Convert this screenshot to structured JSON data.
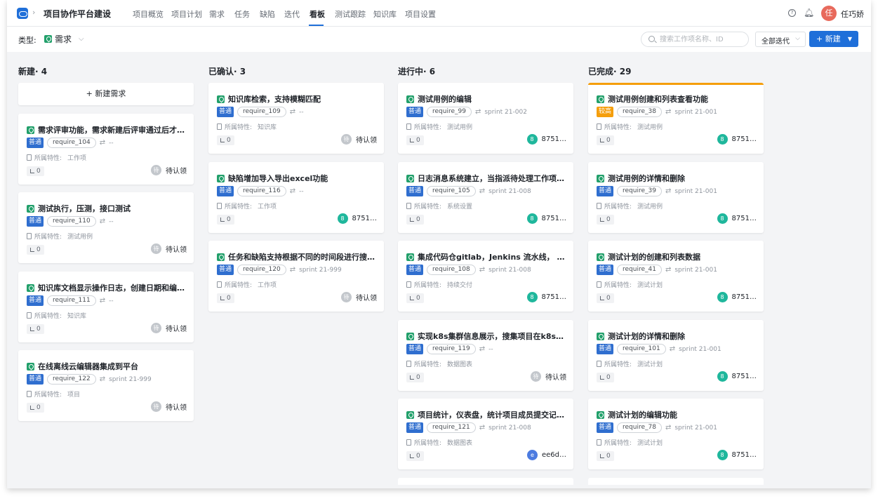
{
  "topnav": {
    "project_name": "项目协作平台建设",
    "tabs": [
      "项目概览",
      "项目计划",
      "需求",
      "任务",
      "缺陷",
      "迭代",
      "看板",
      "测试跟踪",
      "知识库",
      "项目设置"
    ],
    "active_tab": "看板",
    "user_avatar": "任",
    "user_name": "任巧娇"
  },
  "toolbar": {
    "type_label": "类型:",
    "type_value": "需求",
    "search_placeholder": "搜索工作项名称、ID",
    "iteration_select": "全部迭代",
    "new_button": "新建"
  },
  "labels": {
    "feature_label": "所属特性:",
    "add_requirement": "+ 新建需求"
  },
  "columns": [
    {
      "title": "新建· 4",
      "cards": [
        {
          "title": "需求评审功能，需求新建后评审通过后才能…",
          "priority": "普通",
          "key": "require_104",
          "sprint": "--",
          "feature": "工作项",
          "subtasks": "0",
          "assignee": "待认领",
          "avatar": "待"
        },
        {
          "title": "测试执行，压测，接口测试",
          "priority": "普通",
          "key": "require_110",
          "sprint": "--",
          "feature": "测试用例",
          "subtasks": "0",
          "assignee": "待认领",
          "avatar": "待"
        },
        {
          "title": "知识库文档显示操作日志，创建日期和编辑…",
          "priority": "普通",
          "key": "require_111",
          "sprint": "--",
          "feature": "知识库",
          "subtasks": "0",
          "assignee": "待认领",
          "avatar": "待"
        },
        {
          "title": "在线离线云编辑器集成到平台",
          "priority": "普通",
          "key": "require_122",
          "sprint": "sprint 21-999",
          "feature": "项目",
          "subtasks": "0",
          "assignee": "待认领",
          "avatar": "待"
        }
      ]
    },
    {
      "title": "已确认· 3",
      "cards": [
        {
          "title": "知识库检索，支持模糊匹配",
          "priority": "普通",
          "key": "require_109",
          "sprint": "--",
          "feature": "知识库",
          "subtasks": "0",
          "assignee": "待认领",
          "avatar": "待"
        },
        {
          "title": "缺陷增加导入导出excel功能",
          "priority": "普通",
          "key": "require_116",
          "sprint": "--",
          "feature": "工作项",
          "subtasks": "0",
          "assignee": "8751…",
          "avatar": "8"
        },
        {
          "title": "任务和缺陷支持根据不同的时间段进行搜索…",
          "priority": "普通",
          "key": "require_120",
          "sprint": "sprint 21-999",
          "feature": "工作项",
          "subtasks": "0",
          "assignee": "待认领",
          "avatar": "待"
        }
      ]
    },
    {
      "title": "进行中· 6",
      "cards": [
        {
          "title": "测试用例的编辑",
          "priority": "普通",
          "key": "require_99",
          "sprint": "sprint 21-002",
          "feature": "测试用例",
          "subtasks": "0",
          "assignee": "8751…",
          "avatar": "8"
        },
        {
          "title": "日志消息系统建立，当指派待处理工作项，…",
          "priority": "普通",
          "key": "require_105",
          "sprint": "sprint 21-008",
          "feature": "系统设置",
          "subtasks": "0",
          "assignee": "8751…",
          "avatar": "8"
        },
        {
          "title": "集成代码仓gitlab，Jenkins 流水线， 部署…",
          "priority": "普通",
          "key": "require_108",
          "sprint": "sprint 21-008",
          "feature": "持续交付",
          "subtasks": "0",
          "assignee": "8751…",
          "avatar": "8"
        },
        {
          "title": "实现k8s集群信息展示，搜集项目在k8s的命…",
          "priority": "普通",
          "key": "require_119",
          "sprint": "--",
          "feature": "数据图表",
          "subtasks": "0",
          "assignee": "待认领",
          "avatar": "待"
        },
        {
          "title": "项目统计，仪表盘，统计项目成员提交记录…",
          "priority": "普通",
          "key": "require_121",
          "sprint": "sprint 21-008",
          "feature": "数据图表",
          "subtasks": "0",
          "assignee": "ee6d…",
          "avatar": "e"
        }
      ]
    },
    {
      "title": "已完成· 29",
      "cards": [
        {
          "title": "测试用例创建和列表查看功能",
          "priority": "较高",
          "key": "require_38",
          "sprint": "sprint 21-001",
          "feature": "测试用例",
          "subtasks": "0",
          "assignee": "8751…",
          "avatar": "8"
        },
        {
          "title": "测试用例的详情和删除",
          "priority": "普通",
          "key": "require_39",
          "sprint": "sprint 21-001",
          "feature": "测试用例",
          "subtasks": "0",
          "assignee": "8751…",
          "avatar": "8"
        },
        {
          "title": "测试计划的创建和列表数据",
          "priority": "普通",
          "key": "require_41",
          "sprint": "sprint 21-001",
          "feature": "测试计划",
          "subtasks": "0",
          "assignee": "8751…",
          "avatar": "8"
        },
        {
          "title": "测试计划的详情和删除",
          "priority": "普通",
          "key": "require_101",
          "sprint": "sprint 21-001",
          "feature": "测试计划",
          "subtasks": "0",
          "assignee": "8751…",
          "avatar": "8"
        },
        {
          "title": "测试计划的编辑功能",
          "priority": "普通",
          "key": "require_78",
          "sprint": "sprint 21-001",
          "feature": "测试计划",
          "subtasks": "0",
          "assignee": "8751…",
          "avatar": "8"
        }
      ]
    }
  ]
}
